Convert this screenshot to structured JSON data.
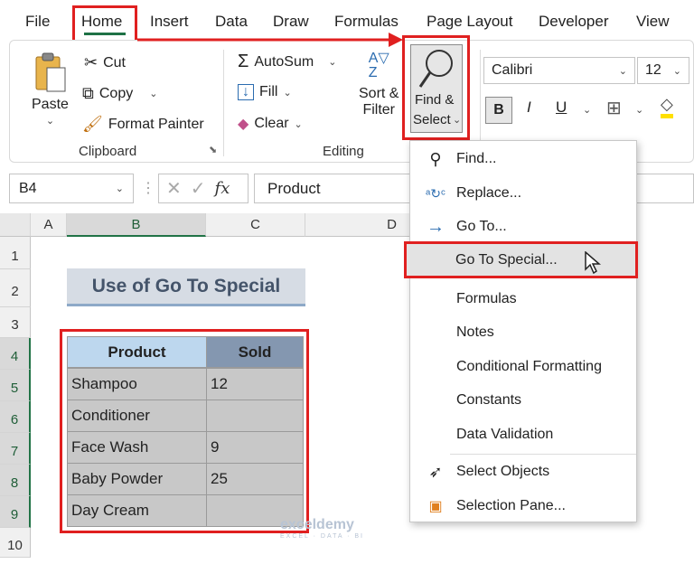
{
  "menu": [
    "File",
    "Home",
    "Insert",
    "Data",
    "Draw",
    "Formulas",
    "Page Layout",
    "Developer",
    "View"
  ],
  "clipboard": {
    "paste": "Paste",
    "cut": "Cut",
    "copy": "Copy",
    "format_painter": "Format Painter",
    "group": "Clipboard"
  },
  "editing": {
    "autosum": "AutoSum",
    "fill": "Fill",
    "clear": "Clear",
    "sort_line1": "Sort &",
    "sort_line2": "Filter",
    "find_line1": "Find &",
    "find_line2": "Select",
    "group": "Editing"
  },
  "font": {
    "name": "Calibri",
    "size": "12",
    "bold": "B",
    "italic": "I",
    "underline": "U"
  },
  "formula_bar": {
    "name_box": "B4",
    "fx": "fx",
    "content": "Product"
  },
  "columns": [
    "A",
    "B",
    "C",
    "D"
  ],
  "rows": [
    "1",
    "2",
    "3",
    "4",
    "5",
    "6",
    "7",
    "8",
    "9",
    "10"
  ],
  "sheet_title": "Use of Go To Special",
  "table": {
    "headers": [
      "Product",
      "Sold"
    ],
    "rows": [
      [
        "Shampoo",
        "12"
      ],
      [
        "Conditioner",
        ""
      ],
      [
        "Face Wash",
        "9"
      ],
      [
        "Baby Powder",
        "25"
      ],
      [
        "Day Cream",
        ""
      ]
    ]
  },
  "dropdown": {
    "find": "Find...",
    "replace": "Replace...",
    "goto": "Go To...",
    "goto_special": "Go To Special...",
    "formulas": "Formulas",
    "notes": "Notes",
    "conditional_formatting": "Conditional Formatting",
    "constants": "Constants",
    "data_validation": "Data Validation",
    "select_objects": "Select Objects",
    "selection_pane": "Selection Pane..."
  },
  "watermark": {
    "name": "exceldemy",
    "tag": "EXCEL · DATA · BI"
  },
  "colors": {
    "highlight": "#e02020",
    "excel_green": "#217346",
    "title_fill": "#d6dce4"
  }
}
